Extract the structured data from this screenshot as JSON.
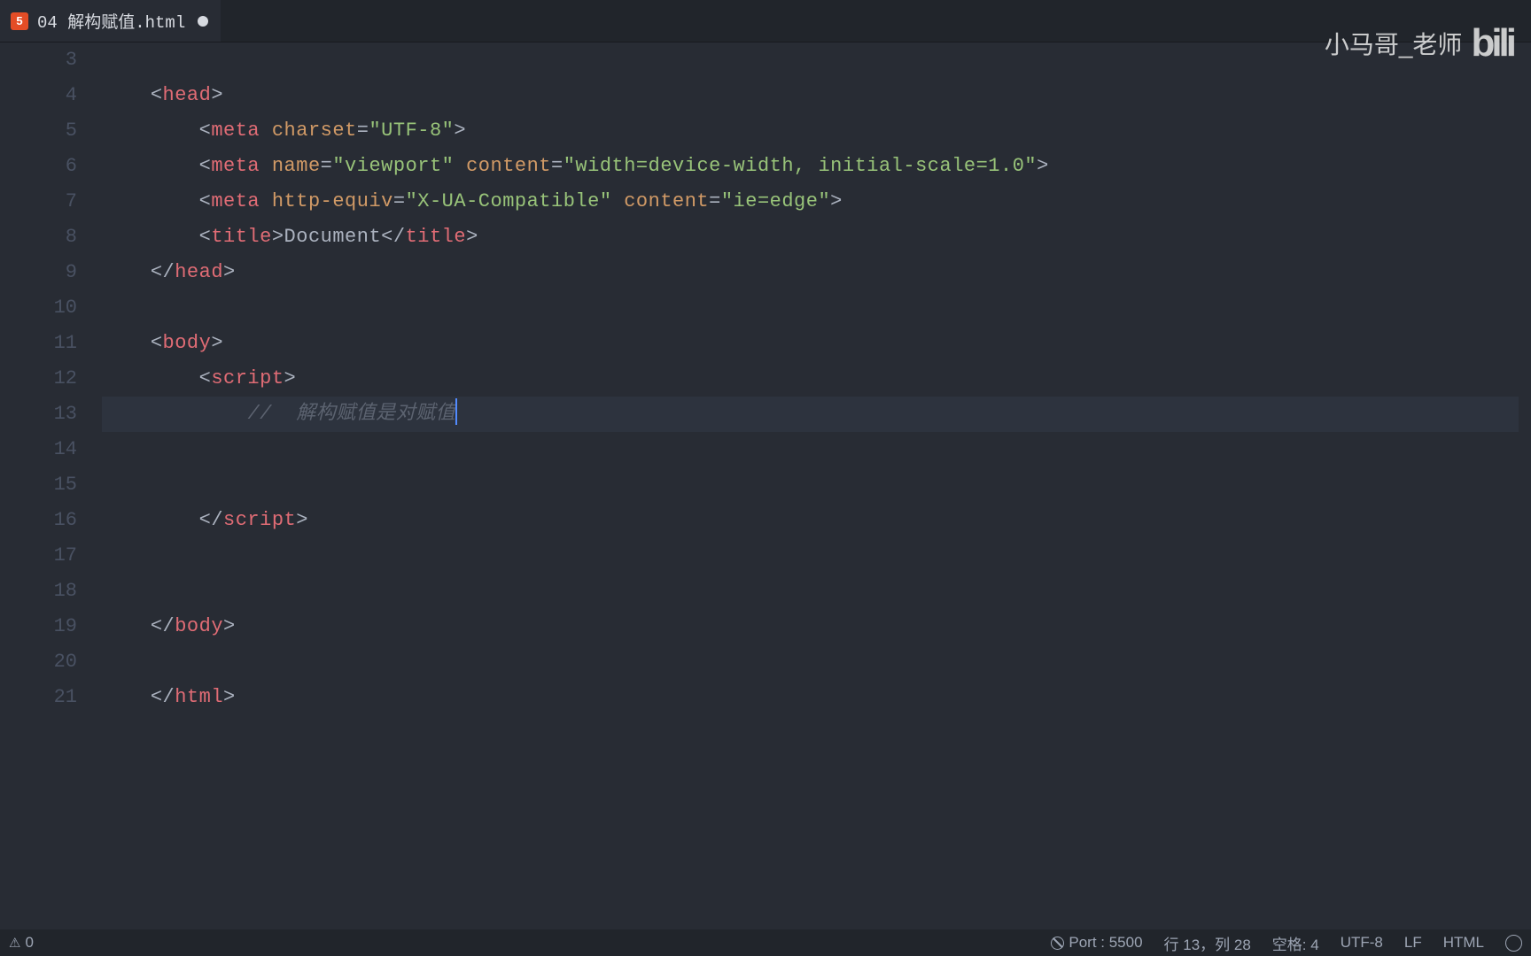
{
  "tab": {
    "filename": "04 解构赋值.html",
    "file_icon_text": "5",
    "dirty": true
  },
  "watermark": {
    "text": "小马哥_老师",
    "logo": "bili"
  },
  "gutter": {
    "start": 3,
    "end": 21
  },
  "code_lines": [
    {
      "n": 3,
      "indent": 0,
      "tokens": []
    },
    {
      "n": 4,
      "indent": 0,
      "tokens": [
        [
          "punct",
          "<"
        ],
        [
          "tagname",
          "head"
        ],
        [
          "punct",
          ">"
        ]
      ]
    },
    {
      "n": 5,
      "indent": 1,
      "tokens": [
        [
          "punct",
          "<"
        ],
        [
          "tagname",
          "meta"
        ],
        [
          "plain",
          " "
        ],
        [
          "attr",
          "charset"
        ],
        [
          "punct",
          "="
        ],
        [
          "string",
          "\"UTF-8\""
        ],
        [
          "punct",
          ">"
        ]
      ]
    },
    {
      "n": 6,
      "indent": 1,
      "tokens": [
        [
          "punct",
          "<"
        ],
        [
          "tagname",
          "meta"
        ],
        [
          "plain",
          " "
        ],
        [
          "attr",
          "name"
        ],
        [
          "punct",
          "="
        ],
        [
          "string",
          "\"viewport\""
        ],
        [
          "plain",
          " "
        ],
        [
          "attr",
          "content"
        ],
        [
          "punct",
          "="
        ],
        [
          "string",
          "\"width=device-width, initial-scale=1.0\""
        ],
        [
          "punct",
          ">"
        ]
      ]
    },
    {
      "n": 7,
      "indent": 1,
      "tokens": [
        [
          "punct",
          "<"
        ],
        [
          "tagname",
          "meta"
        ],
        [
          "plain",
          " "
        ],
        [
          "attr",
          "http-equiv"
        ],
        [
          "punct",
          "="
        ],
        [
          "string",
          "\"X-UA-Compatible\""
        ],
        [
          "plain",
          " "
        ],
        [
          "attr",
          "content"
        ],
        [
          "punct",
          "="
        ],
        [
          "string",
          "\"ie=edge\""
        ],
        [
          "punct",
          ">"
        ]
      ]
    },
    {
      "n": 8,
      "indent": 1,
      "tokens": [
        [
          "punct",
          "<"
        ],
        [
          "tagname",
          "title"
        ],
        [
          "punct",
          ">"
        ],
        [
          "plain",
          "Document"
        ],
        [
          "punct",
          "</"
        ],
        [
          "tagname",
          "title"
        ],
        [
          "punct",
          ">"
        ]
      ]
    },
    {
      "n": 9,
      "indent": 0,
      "tokens": [
        [
          "punct",
          "</"
        ],
        [
          "tagname",
          "head"
        ],
        [
          "punct",
          ">"
        ]
      ]
    },
    {
      "n": 10,
      "indent": 0,
      "tokens": []
    },
    {
      "n": 11,
      "indent": 0,
      "tokens": [
        [
          "punct",
          "<"
        ],
        [
          "tagname",
          "body"
        ],
        [
          "punct",
          ">"
        ]
      ]
    },
    {
      "n": 12,
      "indent": 1,
      "tokens": [
        [
          "punct",
          "<"
        ],
        [
          "tagname",
          "script"
        ],
        [
          "punct",
          ">"
        ]
      ]
    },
    {
      "n": 13,
      "indent": 2,
      "tokens": [
        [
          "comment",
          "//  解构赋值是对赋值"
        ]
      ],
      "cursor": true,
      "highlight": true
    },
    {
      "n": 14,
      "indent": 2,
      "tokens": []
    },
    {
      "n": 15,
      "indent": 2,
      "tokens": []
    },
    {
      "n": 16,
      "indent": 1,
      "tokens": [
        [
          "punct",
          "</"
        ],
        [
          "tagname",
          "script"
        ],
        [
          "punct",
          ">"
        ]
      ]
    },
    {
      "n": 17,
      "indent": 0,
      "tokens": []
    },
    {
      "n": 18,
      "indent": 0,
      "tokens": []
    },
    {
      "n": 19,
      "indent": 0,
      "tokens": [
        [
          "punct",
          "</"
        ],
        [
          "tagname",
          "body"
        ],
        [
          "punct",
          ">"
        ]
      ]
    },
    {
      "n": 20,
      "indent": 0,
      "tokens": []
    },
    {
      "n": 21,
      "indent": 0,
      "tokens": [
        [
          "punct",
          "</"
        ],
        [
          "tagname",
          "html"
        ],
        [
          "punct",
          ">"
        ]
      ]
    }
  ],
  "status": {
    "problems": "0",
    "port": "Port : 5500",
    "cursor_pos": "行 13，列 28",
    "spaces": "空格: 4",
    "encoding": "UTF-8",
    "eol": "LF",
    "language": "HTML"
  }
}
